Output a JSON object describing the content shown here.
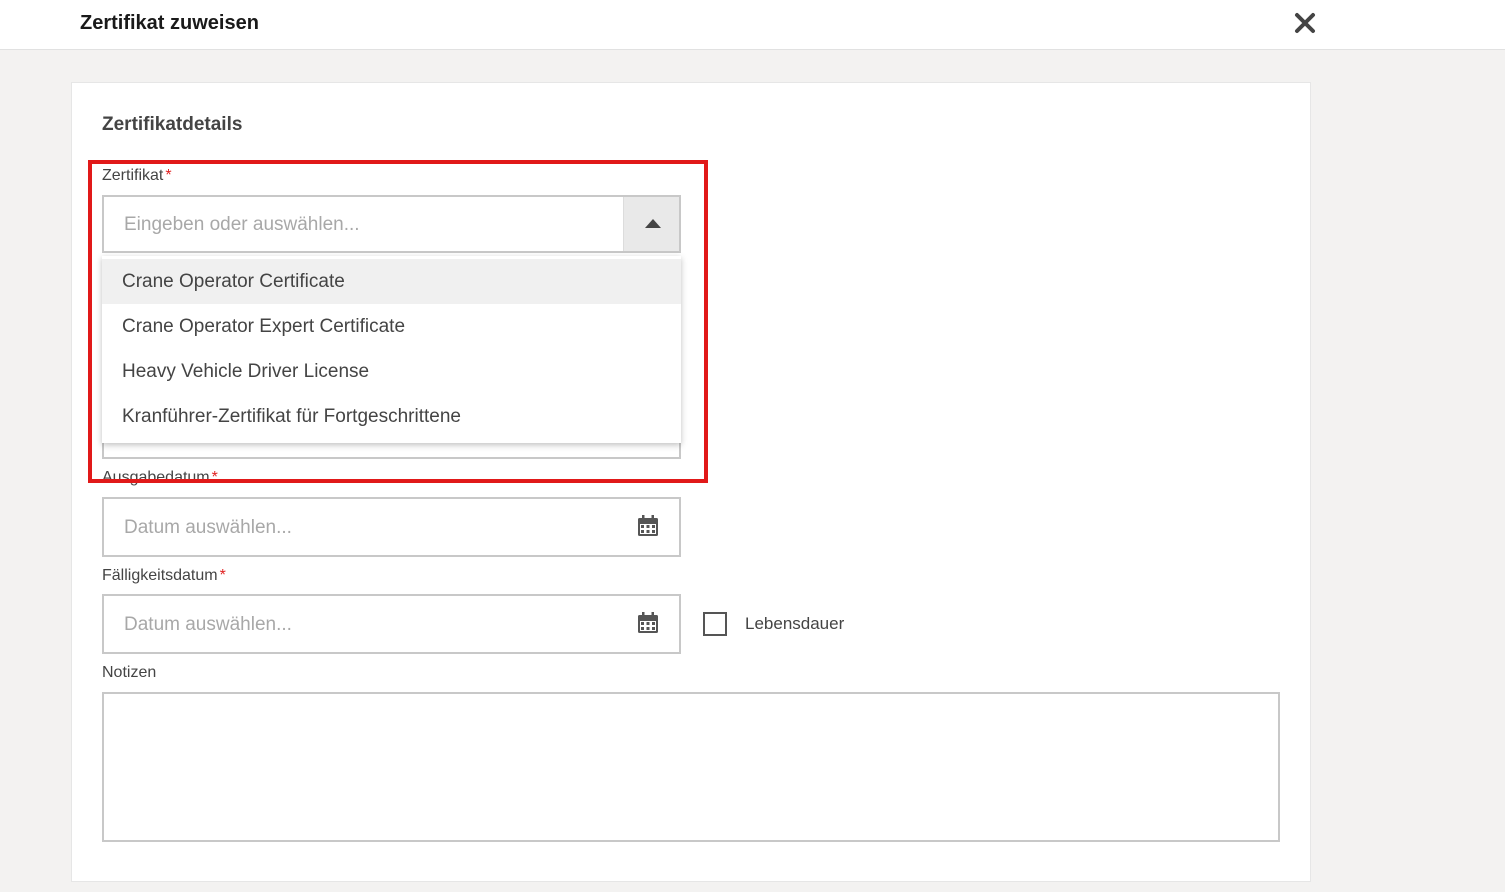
{
  "dialog": {
    "title": "Zertifikat zuweisen"
  },
  "section": {
    "title": "Zertifikatdetails"
  },
  "fields": {
    "certificate": {
      "label": "Zertifikat",
      "required_mark": "*",
      "placeholder": "Eingeben oder auswählen...",
      "options": [
        "Crane Operator Certificate",
        "Crane Operator Expert Certificate",
        "Heavy Vehicle Driver License",
        "Kranführer-Zertifikat für Fortgeschrittene"
      ]
    },
    "issue_date": {
      "label": "Ausgabedatum",
      "required_mark": "*",
      "placeholder": "Datum auswählen..."
    },
    "due_date": {
      "label": "Fälligkeitsdatum",
      "required_mark": "*",
      "placeholder": "Datum auswählen..."
    },
    "lifetime": {
      "label": "Lebensdauer",
      "checked": false
    },
    "notes": {
      "label": "Notizen",
      "value": ""
    }
  },
  "colors": {
    "highlight": "#e11919",
    "required": "#e02020",
    "background": "#f3f2f1"
  },
  "icons": {
    "close": "close-icon",
    "dropdown_toggle": "caret-up-icon",
    "calendar": "calendar-icon"
  }
}
